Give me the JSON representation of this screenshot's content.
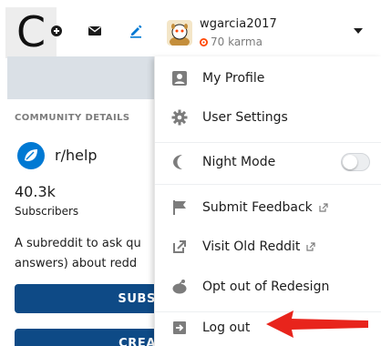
{
  "header": {
    "logo_letter": "C",
    "user": {
      "username": "wgarcia2017",
      "karma": "70 karma"
    }
  },
  "community": {
    "heading": "COMMUNITY DETAILS",
    "name": "r/help",
    "subscriber_count": "40.3k",
    "subscriber_label": "Subscribers",
    "description_line1": "A subreddit to ask qu",
    "description_line2": "answers) about redd",
    "subscribe_label": "SUBS",
    "create_label": "CREA"
  },
  "menu": {
    "items": [
      {
        "label": "My Profile",
        "icon": "profile-icon"
      },
      {
        "label": "User Settings",
        "icon": "gear-icon"
      },
      {
        "label": "Night Mode",
        "icon": "moon-icon",
        "toggle": false
      },
      {
        "label": "Submit Feedback",
        "icon": "flag-icon",
        "external": true
      },
      {
        "label": "Visit Old Reddit",
        "icon": "external-link-icon",
        "external": true
      },
      {
        "label": "Opt out of Redesign",
        "icon": "redesign-icon"
      },
      {
        "label": "Log out",
        "icon": "logout-icon"
      }
    ]
  },
  "colors": {
    "accent_blue": "#0e4a86",
    "icon_blue": "#0079d3",
    "karma_orange": "#ff4500",
    "annotation_red": "#e8241c",
    "menu_icon_gray": "#7c7c7c"
  }
}
